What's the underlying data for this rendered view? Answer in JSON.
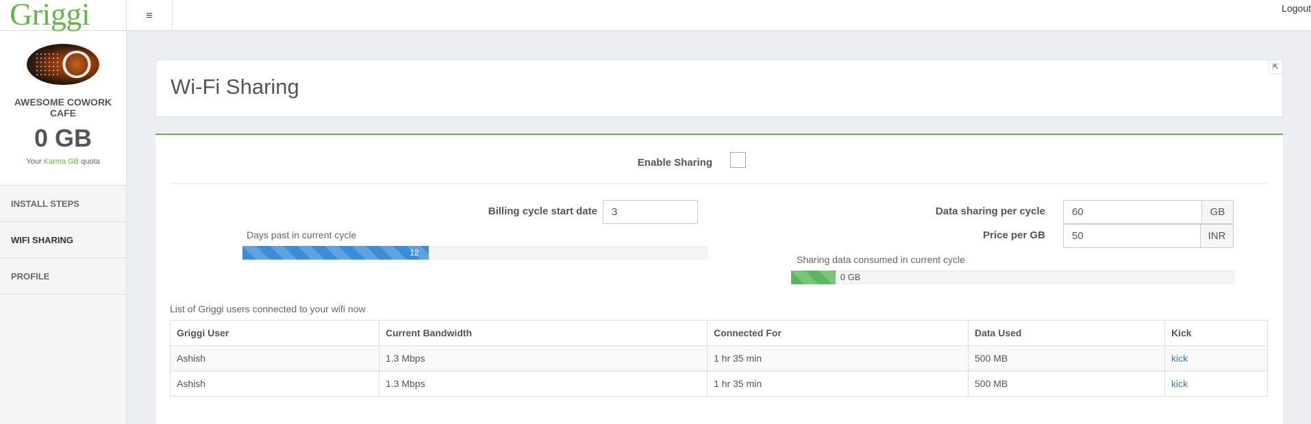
{
  "app": {
    "logo": "Griggi"
  },
  "sidebar": {
    "venue_name": "AWESOME COWORK CAFE",
    "quota_value": "0 GB",
    "quota_prefix": "Your",
    "quota_link": "Karma GB",
    "quota_suffix": "quota",
    "items": [
      {
        "label": "INSTALL STEPS"
      },
      {
        "label": "WIFI SHARING"
      },
      {
        "label": "PROFILE"
      }
    ]
  },
  "topbar": {
    "menu_icon": "≡",
    "logout_label": "Logout"
  },
  "page": {
    "title": "Wi-Fi Sharing",
    "expand_icon": "⇱"
  },
  "settings": {
    "enable_label": "Enable Sharing",
    "enable_checked": false,
    "billing_label": "Billing cycle start date",
    "billing_value": "3",
    "days_caption": "Days past in current cycle",
    "days_progress_label": "12",
    "days_progress_fraction": 0.4,
    "data_label": "Data sharing per cycle",
    "data_value": "60",
    "data_unit": "GB",
    "price_label": "Price per GB",
    "price_value": "50",
    "price_unit": "INR",
    "consumed_caption": "Sharing data consumed in current cycle",
    "consumed_label": "0 GB",
    "consumed_fraction": 0.1
  },
  "table": {
    "caption": "List of Griggi users connected to your wifi now",
    "headers": [
      "Griggi User",
      "Current Bandwidth",
      "Connected For",
      "Data Used",
      "Kick"
    ],
    "rows": [
      {
        "user": "Ashish",
        "bandwidth": "1.3 Mbps",
        "connected": "1 hr 35 min",
        "data_used": "500 MB",
        "kick": "kick"
      },
      {
        "user": "Ashish",
        "bandwidth": "1.3 Mbps",
        "connected": "1 hr 35 min",
        "data_used": "500 MB",
        "kick": "kick"
      }
    ]
  },
  "colors": {
    "brand": "#63b844",
    "progress_blue": "#3c8dd9",
    "progress_green": "#5cb85c",
    "link": "#337ab7"
  }
}
